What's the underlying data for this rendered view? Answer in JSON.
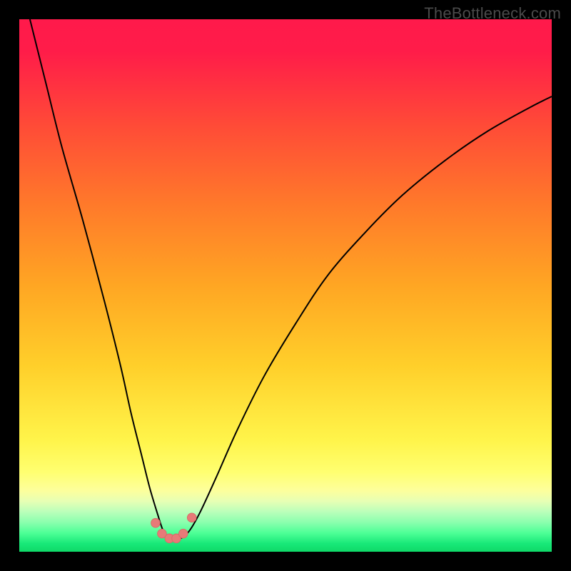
{
  "watermark": "TheBottleneck.com",
  "colors": {
    "bg": "#000000",
    "curve": "#000000",
    "marker_fill": "#e77a78",
    "marker_stroke": "#d86a66",
    "gradient_stops": [
      {
        "offset": 0.0,
        "color": "#ff1a4b"
      },
      {
        "offset": 0.06,
        "color": "#ff1c49"
      },
      {
        "offset": 0.2,
        "color": "#ff4b37"
      },
      {
        "offset": 0.35,
        "color": "#ff7a2a"
      },
      {
        "offset": 0.5,
        "color": "#ffa623"
      },
      {
        "offset": 0.65,
        "color": "#ffcf2a"
      },
      {
        "offset": 0.79,
        "color": "#fff44a"
      },
      {
        "offset": 0.85,
        "color": "#ffff70"
      },
      {
        "offset": 0.885,
        "color": "#fdff9c"
      },
      {
        "offset": 0.905,
        "color": "#e7ffb4"
      },
      {
        "offset": 0.925,
        "color": "#baffba"
      },
      {
        "offset": 0.945,
        "color": "#8affae"
      },
      {
        "offset": 0.965,
        "color": "#4dff96"
      },
      {
        "offset": 0.985,
        "color": "#18e878"
      },
      {
        "offset": 1.0,
        "color": "#0fd968"
      }
    ]
  },
  "chart_data": {
    "type": "line",
    "title": "",
    "xlabel": "",
    "ylabel": "",
    "xlim": [
      0,
      100
    ],
    "ylim": [
      0,
      100
    ],
    "legend": false,
    "grid": false,
    "series": [
      {
        "name": "bottleneck-curve",
        "x": [
          2,
          5,
          8,
          12,
          16,
          19,
          21,
          23,
          24.5,
          26,
          27,
          28,
          29,
          30.5,
          32,
          34,
          37,
          41,
          46,
          52,
          58,
          65,
          72,
          80,
          88,
          96,
          100
        ],
        "y": [
          100,
          88,
          76,
          62,
          47,
          35,
          26,
          18,
          12,
          7,
          4.0,
          2.6,
          2.2,
          2.6,
          4.0,
          7.5,
          14,
          23,
          33,
          43,
          52,
          60,
          67,
          73.5,
          79,
          83.5,
          85.5
        ]
      }
    ],
    "markers": {
      "name": "trough-points",
      "points": [
        {
          "x": 25.6,
          "y": 5.4
        },
        {
          "x": 26.8,
          "y": 3.4
        },
        {
          "x": 28.2,
          "y": 2.5
        },
        {
          "x": 29.5,
          "y": 2.5
        },
        {
          "x": 30.8,
          "y": 3.4
        },
        {
          "x": 32.4,
          "y": 6.4
        }
      ],
      "radius_pct": 0.85
    }
  }
}
